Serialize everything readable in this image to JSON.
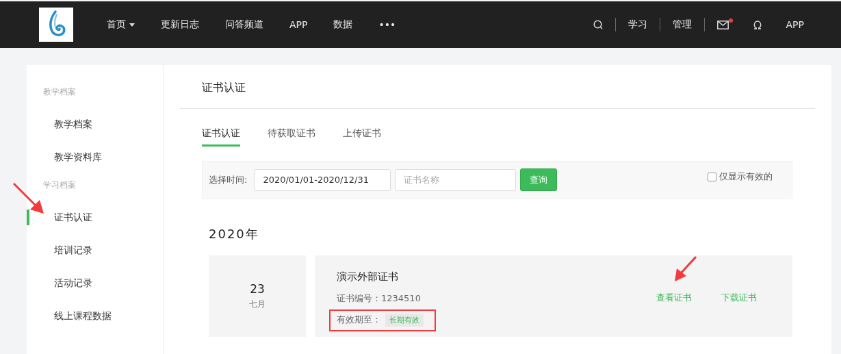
{
  "nav": {
    "items": [
      {
        "label": "首页",
        "kind": "dropdown"
      },
      {
        "label": "更新日志",
        "kind": "link"
      },
      {
        "label": "问答频道",
        "kind": "link"
      },
      {
        "label": "APP",
        "kind": "link"
      },
      {
        "label": "数据",
        "kind": "link"
      },
      {
        "label": "•••",
        "kind": "link"
      }
    ],
    "right": [
      {
        "kind": "search"
      },
      {
        "kind": "text",
        "label": "学习"
      },
      {
        "kind": "text",
        "label": "管理"
      },
      {
        "kind": "mail",
        "unread": true
      },
      {
        "kind": "omega"
      },
      {
        "kind": "text",
        "label": "APP"
      }
    ]
  },
  "sidebar": {
    "groups": [
      {
        "label": "教学档案",
        "items": [
          {
            "label": "教学档案",
            "selected": false
          },
          {
            "label": "教学资料库",
            "selected": false
          }
        ]
      },
      {
        "label": "学习档案",
        "items": [
          {
            "label": "证书认证",
            "selected": true
          },
          {
            "label": "培训记录",
            "selected": false
          },
          {
            "label": "活动记录",
            "selected": false
          },
          {
            "label": "线上课程数据",
            "selected": false
          }
        ]
      }
    ]
  },
  "page_title": "证书认证",
  "tabs": [
    {
      "label": "证书认证",
      "selected": true
    },
    {
      "label": "待获取证书",
      "selected": false
    },
    {
      "label": "上传证书",
      "selected": false
    }
  ],
  "filter": {
    "label": "选择时间:",
    "date_range": "2020/01/01-2020/12/31",
    "name_placeholder": "证书名称",
    "query_button": "查询",
    "only_valid": {
      "label": "仅显示有效的",
      "checked": false
    }
  },
  "year": "2020年",
  "certificates": [
    {
      "day": "23",
      "month": "七月",
      "name": "演示外部证书",
      "number": "证书编号：1234510",
      "validity_label": "有效期至：",
      "validity": "长期有效",
      "actions": [
        "查看证书",
        "下载证书"
      ]
    }
  ]
}
